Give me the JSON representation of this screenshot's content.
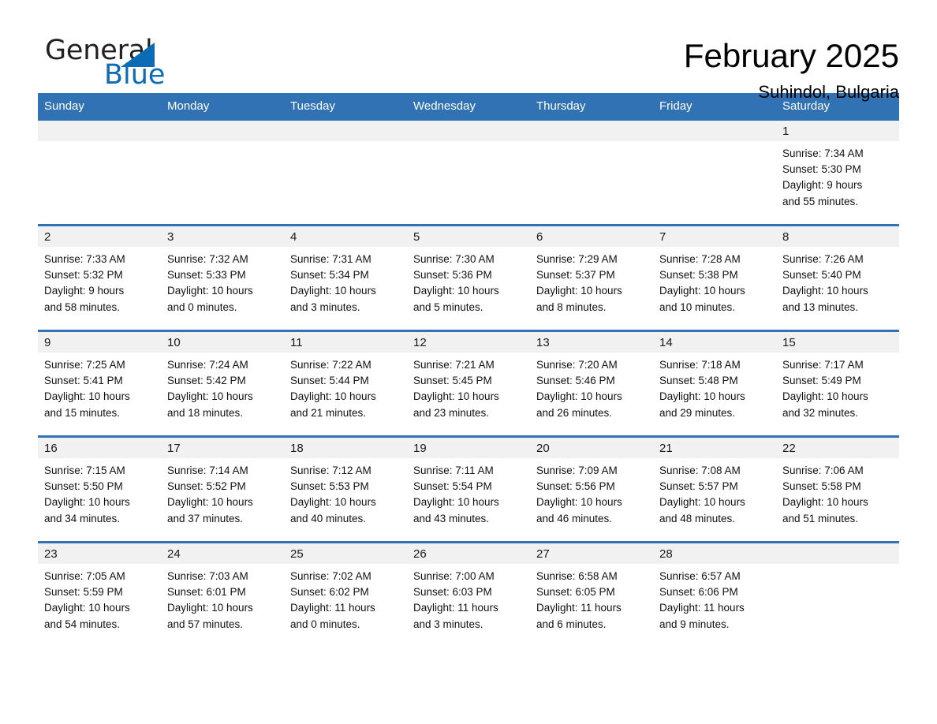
{
  "brand": {
    "name_part1": "General",
    "name_part2": "Blue",
    "logo_icon": "triangle-icon",
    "accent_color": "#0b6cb5"
  },
  "header": {
    "title": "February 2025",
    "subtitle": "Suhindol, Bulgaria"
  },
  "theme": {
    "header_blue": "#3072b3",
    "day_band_gray": "#f1f1f1",
    "text_color": "#111111"
  },
  "calendar": {
    "weekdays": [
      "Sunday",
      "Monday",
      "Tuesday",
      "Wednesday",
      "Thursday",
      "Friday",
      "Saturday"
    ],
    "weeks": [
      [
        {
          "day": "",
          "empty": true
        },
        {
          "day": "",
          "empty": true
        },
        {
          "day": "",
          "empty": true
        },
        {
          "day": "",
          "empty": true
        },
        {
          "day": "",
          "empty": true
        },
        {
          "day": "",
          "empty": true
        },
        {
          "day": "1",
          "sunrise": "Sunrise: 7:34 AM",
          "sunset": "Sunset: 5:30 PM",
          "daylight1": "Daylight: 9 hours",
          "daylight2": "and 55 minutes."
        }
      ],
      [
        {
          "day": "2",
          "sunrise": "Sunrise: 7:33 AM",
          "sunset": "Sunset: 5:32 PM",
          "daylight1": "Daylight: 9 hours",
          "daylight2": "and 58 minutes."
        },
        {
          "day": "3",
          "sunrise": "Sunrise: 7:32 AM",
          "sunset": "Sunset: 5:33 PM",
          "daylight1": "Daylight: 10 hours",
          "daylight2": "and 0 minutes."
        },
        {
          "day": "4",
          "sunrise": "Sunrise: 7:31 AM",
          "sunset": "Sunset: 5:34 PM",
          "daylight1": "Daylight: 10 hours",
          "daylight2": "and 3 minutes."
        },
        {
          "day": "5",
          "sunrise": "Sunrise: 7:30 AM",
          "sunset": "Sunset: 5:36 PM",
          "daylight1": "Daylight: 10 hours",
          "daylight2": "and 5 minutes."
        },
        {
          "day": "6",
          "sunrise": "Sunrise: 7:29 AM",
          "sunset": "Sunset: 5:37 PM",
          "daylight1": "Daylight: 10 hours",
          "daylight2": "and 8 minutes."
        },
        {
          "day": "7",
          "sunrise": "Sunrise: 7:28 AM",
          "sunset": "Sunset: 5:38 PM",
          "daylight1": "Daylight: 10 hours",
          "daylight2": "and 10 minutes."
        },
        {
          "day": "8",
          "sunrise": "Sunrise: 7:26 AM",
          "sunset": "Sunset: 5:40 PM",
          "daylight1": "Daylight: 10 hours",
          "daylight2": "and 13 minutes."
        }
      ],
      [
        {
          "day": "9",
          "sunrise": "Sunrise: 7:25 AM",
          "sunset": "Sunset: 5:41 PM",
          "daylight1": "Daylight: 10 hours",
          "daylight2": "and 15 minutes."
        },
        {
          "day": "10",
          "sunrise": "Sunrise: 7:24 AM",
          "sunset": "Sunset: 5:42 PM",
          "daylight1": "Daylight: 10 hours",
          "daylight2": "and 18 minutes."
        },
        {
          "day": "11",
          "sunrise": "Sunrise: 7:22 AM",
          "sunset": "Sunset: 5:44 PM",
          "daylight1": "Daylight: 10 hours",
          "daylight2": "and 21 minutes."
        },
        {
          "day": "12",
          "sunrise": "Sunrise: 7:21 AM",
          "sunset": "Sunset: 5:45 PM",
          "daylight1": "Daylight: 10 hours",
          "daylight2": "and 23 minutes."
        },
        {
          "day": "13",
          "sunrise": "Sunrise: 7:20 AM",
          "sunset": "Sunset: 5:46 PM",
          "daylight1": "Daylight: 10 hours",
          "daylight2": "and 26 minutes."
        },
        {
          "day": "14",
          "sunrise": "Sunrise: 7:18 AM",
          "sunset": "Sunset: 5:48 PM",
          "daylight1": "Daylight: 10 hours",
          "daylight2": "and 29 minutes."
        },
        {
          "day": "15",
          "sunrise": "Sunrise: 7:17 AM",
          "sunset": "Sunset: 5:49 PM",
          "daylight1": "Daylight: 10 hours",
          "daylight2": "and 32 minutes."
        }
      ],
      [
        {
          "day": "16",
          "sunrise": "Sunrise: 7:15 AM",
          "sunset": "Sunset: 5:50 PM",
          "daylight1": "Daylight: 10 hours",
          "daylight2": "and 34 minutes."
        },
        {
          "day": "17",
          "sunrise": "Sunrise: 7:14 AM",
          "sunset": "Sunset: 5:52 PM",
          "daylight1": "Daylight: 10 hours",
          "daylight2": "and 37 minutes."
        },
        {
          "day": "18",
          "sunrise": "Sunrise: 7:12 AM",
          "sunset": "Sunset: 5:53 PM",
          "daylight1": "Daylight: 10 hours",
          "daylight2": "and 40 minutes."
        },
        {
          "day": "19",
          "sunrise": "Sunrise: 7:11 AM",
          "sunset": "Sunset: 5:54 PM",
          "daylight1": "Daylight: 10 hours",
          "daylight2": "and 43 minutes."
        },
        {
          "day": "20",
          "sunrise": "Sunrise: 7:09 AM",
          "sunset": "Sunset: 5:56 PM",
          "daylight1": "Daylight: 10 hours",
          "daylight2": "and 46 minutes."
        },
        {
          "day": "21",
          "sunrise": "Sunrise: 7:08 AM",
          "sunset": "Sunset: 5:57 PM",
          "daylight1": "Daylight: 10 hours",
          "daylight2": "and 48 minutes."
        },
        {
          "day": "22",
          "sunrise": "Sunrise: 7:06 AM",
          "sunset": "Sunset: 5:58 PM",
          "daylight1": "Daylight: 10 hours",
          "daylight2": "and 51 minutes."
        }
      ],
      [
        {
          "day": "23",
          "sunrise": "Sunrise: 7:05 AM",
          "sunset": "Sunset: 5:59 PM",
          "daylight1": "Daylight: 10 hours",
          "daylight2": "and 54 minutes."
        },
        {
          "day": "24",
          "sunrise": "Sunrise: 7:03 AM",
          "sunset": "Sunset: 6:01 PM",
          "daylight1": "Daylight: 10 hours",
          "daylight2": "and 57 minutes."
        },
        {
          "day": "25",
          "sunrise": "Sunrise: 7:02 AM",
          "sunset": "Sunset: 6:02 PM",
          "daylight1": "Daylight: 11 hours",
          "daylight2": "and 0 minutes."
        },
        {
          "day": "26",
          "sunrise": "Sunrise: 7:00 AM",
          "sunset": "Sunset: 6:03 PM",
          "daylight1": "Daylight: 11 hours",
          "daylight2": "and 3 minutes."
        },
        {
          "day": "27",
          "sunrise": "Sunrise: 6:58 AM",
          "sunset": "Sunset: 6:05 PM",
          "daylight1": "Daylight: 11 hours",
          "daylight2": "and 6 minutes."
        },
        {
          "day": "28",
          "sunrise": "Sunrise: 6:57 AM",
          "sunset": "Sunset: 6:06 PM",
          "daylight1": "Daylight: 11 hours",
          "daylight2": "and 9 minutes."
        },
        {
          "day": "",
          "empty": true
        }
      ]
    ]
  }
}
